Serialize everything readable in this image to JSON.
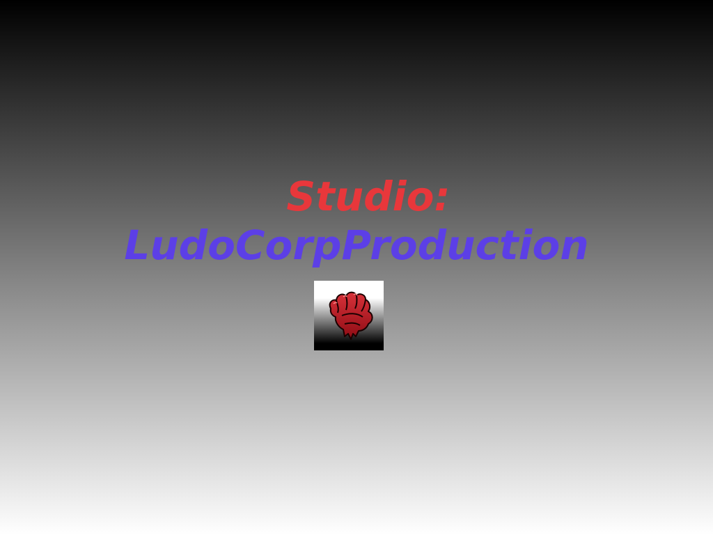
{
  "splash": {
    "studio_label": "Studio:",
    "studio_name": "LudoCorpProduction",
    "logo_icon": "raised-fist-icon"
  },
  "colors": {
    "studio_label": "#e8373b",
    "studio_name": "#5c3fe6",
    "background_top": "#000000",
    "background_bottom": "#ffffff",
    "logo_fist": "#b3121c"
  }
}
